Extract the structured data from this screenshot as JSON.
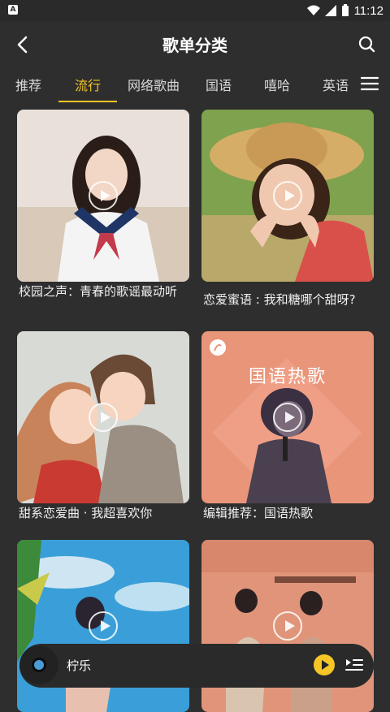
{
  "status_bar": {
    "time": "11:12"
  },
  "header": {
    "title": "歌单分类"
  },
  "tabs": [
    "推荐",
    "流行",
    "网络歌曲",
    "国语",
    "嘻哈",
    "英语"
  ],
  "active_tab": "流行",
  "playlists": [
    {
      "title": "校园之声：青春的歌谣最动听",
      "cover_text": ""
    },
    {
      "title": "恋爱蜜语 : 我和糖哪个甜呀?",
      "cover_text": ""
    },
    {
      "title": "甜系恋爱曲 · 我超喜欢你",
      "cover_text": ""
    },
    {
      "title": "编辑推荐：国语热歌",
      "cover_text": "国语热歌"
    },
    {
      "title": "",
      "cover_text": ""
    },
    {
      "title": "",
      "cover_text": ""
    }
  ],
  "player": {
    "song_title": "柠乐"
  },
  "colors": {
    "accent": "#f5c626",
    "background": "#2e2e2e"
  },
  "icons": [
    "back-icon",
    "search-icon",
    "menu-icon",
    "play-icon",
    "playlist-icon"
  ]
}
